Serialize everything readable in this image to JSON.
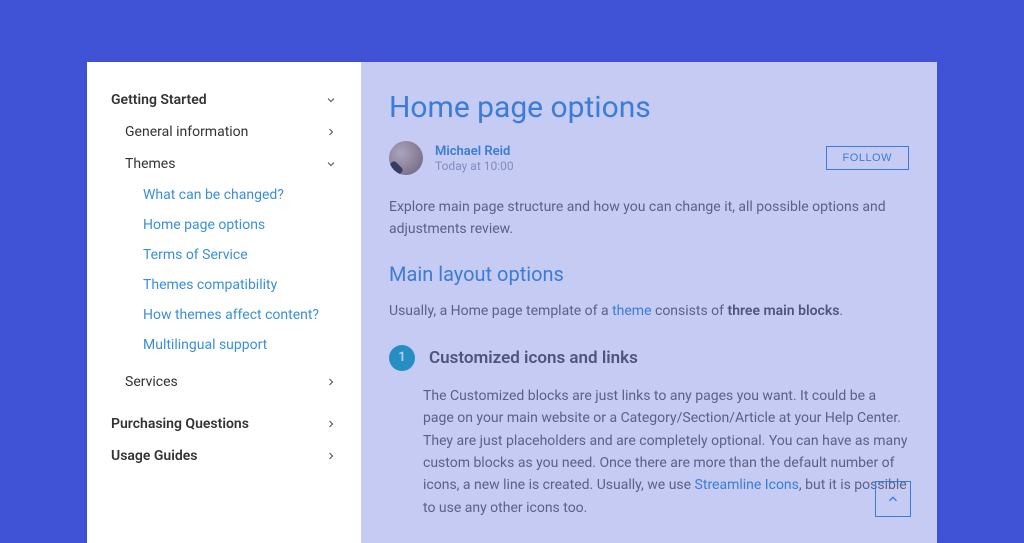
{
  "sidebar": {
    "sections": [
      {
        "label": "Getting Started",
        "expanded": true
      },
      {
        "label": "Purchasing Questions",
        "expanded": false
      },
      {
        "label": "Usage Guides",
        "expanded": false
      }
    ],
    "subsections": [
      {
        "label": "General information",
        "expanded": false
      },
      {
        "label": "Themes",
        "expanded": true
      },
      {
        "label": "Services",
        "expanded": false
      }
    ],
    "links": [
      "What can be changed?",
      "Home page options",
      "Terms of Service",
      "Themes compatibility",
      "How themes affect content?",
      "Multilingual support"
    ]
  },
  "page": {
    "title": "Home page options",
    "author_name": "Michael Reid",
    "author_time": "Today at 10:00",
    "follow_label": "FOLLOW",
    "intro": "Explore main page structure and how you can change it, all possible options and adjustments review.",
    "h2": "Main layout options",
    "para1_pre": "Usually, a Home page template of a ",
    "para1_link": "theme",
    "para1_mid": " consists of ",
    "para1_strong": "three main blocks",
    "para1_post": ".",
    "step1_num": "1",
    "step1_title": "Customized icons and links",
    "step1_body_pre": "The Customized blocks are just links to any pages you want. It could be a page on your main website or a Category/Section/Article at your Help Center. They are just placeholders and are completely optional. You can have as many custom blocks as you need. Once there are more than the default number of icons, a new line is created. Usually, we use ",
    "step1_body_link": "Streamline Icons",
    "step1_body_post": ", but it is possible to use any other icons too."
  }
}
